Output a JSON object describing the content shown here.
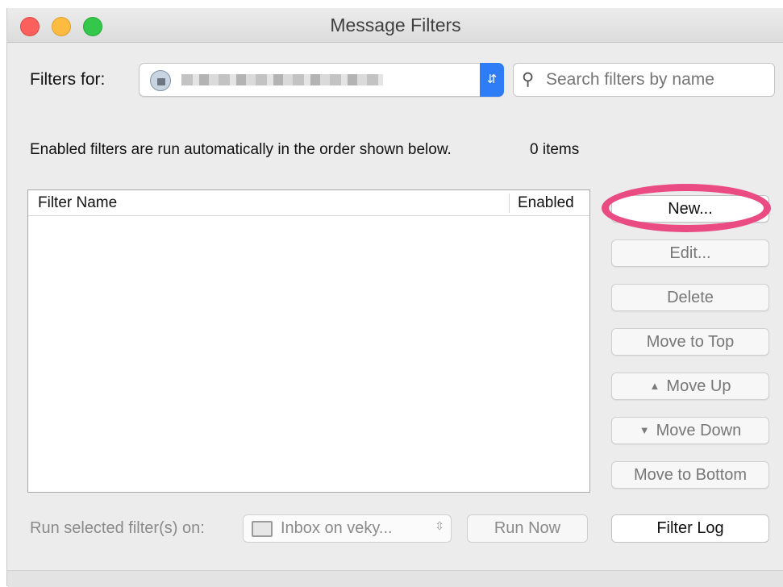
{
  "window": {
    "title": "Message Filters"
  },
  "filters_for": {
    "label": "Filters for:",
    "account_icon": "globe-lock-icon",
    "stepper_icon": "up-down-chevron-icon"
  },
  "search": {
    "placeholder": "Search filters by name",
    "icon": "magnifier-icon"
  },
  "description": "Enabled filters are run automatically in the order shown below.",
  "item_count": "0 items",
  "table": {
    "columns": [
      "Filter Name",
      "Enabled"
    ],
    "rows": []
  },
  "buttons": {
    "new": "New...",
    "edit": "Edit...",
    "delete": "Delete",
    "move_to_top": "Move to Top",
    "move_up": "Move Up",
    "move_down": "Move Down",
    "move_to_bottom": "Move to Bottom"
  },
  "footer": {
    "run_label": "Run selected filter(s) on:",
    "folder": "Inbox on veky...",
    "run_now": "Run Now",
    "filter_log": "Filter Log"
  },
  "colors": {
    "accent": "#2f7df6",
    "highlight": "#ea4b82"
  }
}
